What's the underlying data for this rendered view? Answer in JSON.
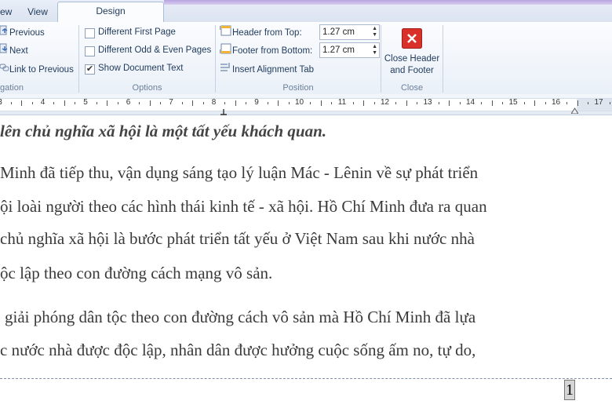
{
  "tabs": [
    "ew",
    "View",
    "Design"
  ],
  "navigation": {
    "previous": "Previous",
    "next": "Next",
    "link": "Link to Previous",
    "label": "gation"
  },
  "options": {
    "different_first_page": {
      "label": "Different First Page",
      "checked": false
    },
    "different_odd_even": {
      "label": "Different Odd & Even Pages",
      "checked": false
    },
    "show_document_text": {
      "label": "Show Document Text",
      "checked": true
    },
    "label": "Options"
  },
  "position": {
    "header_from_top": {
      "label": "Header from Top:",
      "value": "1.27 cm"
    },
    "footer_from_bottom": {
      "label": "Footer from Bottom:",
      "value": "1.27 cm"
    },
    "insert_alignment_tab": "Insert Alignment Tab",
    "label": "Position"
  },
  "close": {
    "button_line1": "Close Header",
    "button_line2": "and Footer",
    "label": "Close"
  },
  "ruler": {
    "numbers": [
      "3",
      "4",
      "5",
      "6",
      "7",
      "8",
      "9",
      "10",
      "11",
      "12",
      "13",
      "14",
      "15",
      "16",
      "17"
    ]
  },
  "document": {
    "lines": [
      "lên chủ nghĩa xã hội là một tất yếu khách quan.",
      "Minh đã tiếp thu, vận dụng sáng tạo lý luận Mác - Lênin về sự phát triển",
      "ội loài người theo các hình thái kinh tế - xã hội. Hồ Chí Minh đưa ra quan",
      "chủ nghĩa xã hội là bước phát triển tất yếu ở Việt Nam sau khi nước nhà",
      "ộc lập theo con đường cách mạng vô sản.",
      "giải phóng dân tộc theo con đường cách vô sản mà Hồ Chí Minh đã lựa",
      "c nước nhà được độc lập, nhân dân được hưởng cuộc sống ấm no, tự do,"
    ],
    "page_number": "1"
  },
  "colors": {
    "ribbon_text": "#1e395b",
    "group_label": "#6a7f9a",
    "close_red": "#d9302a",
    "body_text": "#3a3a3a"
  }
}
